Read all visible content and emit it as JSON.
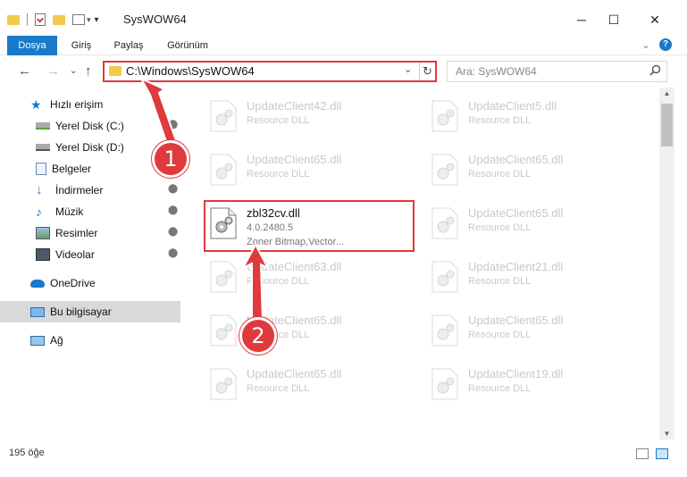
{
  "window": {
    "title": "SysWOW64",
    "minimize_glyph": "─",
    "maximize_glyph": "☐",
    "close_glyph": "✕"
  },
  "ribbon": {
    "tabs": [
      "Dosya",
      "Giriş",
      "Paylaş",
      "Görünüm"
    ],
    "active_tab": "Dosya",
    "collapse_glyph": "⌄",
    "help_glyph": "?"
  },
  "address": {
    "path": "C:\\Windows\\SysWOW64",
    "dropdown_glyph": "⌄",
    "refresh_glyph": "↻"
  },
  "search": {
    "placeholder": "Ara: SysWOW64",
    "icon": "search-icon"
  },
  "nav": {
    "back": "←",
    "forward": "→",
    "recent": "⌄",
    "up": "↑"
  },
  "sidebar": {
    "items": [
      {
        "label": "Hızlı erişim",
        "icon": "star-icon",
        "pinned": false
      },
      {
        "label": "Yerel Disk (C:)",
        "icon": "drive-icon",
        "pinned": true
      },
      {
        "label": "Yerel Disk (D:)",
        "icon": "drive-icon",
        "pinned": true
      },
      {
        "label": "Belgeler",
        "icon": "documents-icon",
        "pinned": true
      },
      {
        "label": "İndirmeler",
        "icon": "downloads-icon",
        "pinned": true
      },
      {
        "label": "Müzik",
        "icon": "music-icon",
        "pinned": true
      },
      {
        "label": "Resimler",
        "icon": "pictures-icon",
        "pinned": true
      },
      {
        "label": "Videolar",
        "icon": "videos-icon",
        "pinned": true
      },
      {
        "label": "OneDrive",
        "icon": "cloud-icon",
        "pinned": false
      },
      {
        "label": "Bu bilgisayar",
        "icon": "computer-icon",
        "pinned": false,
        "selected": true
      },
      {
        "label": "Ağ",
        "icon": "network-icon",
        "pinned": false
      }
    ],
    "pin_glyph": "📌"
  },
  "files": {
    "left_column": [
      {
        "name": "UpdateClient42.dll",
        "desc": "Resource DLL"
      },
      {
        "name": "UpdateClient65.dll",
        "desc": "Resource DLL"
      },
      {
        "name": "UpdateClient63.dll",
        "desc": "Resource DLL"
      },
      {
        "name": "UpdateClient65.dll",
        "desc": "Resource DLL"
      },
      {
        "name": "UpdateClient65.dll",
        "desc": "Resource DLL"
      }
    ],
    "right_column": [
      {
        "name": "UpdateClient5.dll",
        "desc": "Resource DLL"
      },
      {
        "name": "UpdateClient65.dll",
        "desc": "Resource DLL"
      },
      {
        "name": "UpdateClient65.dll",
        "desc": "Resource DLL"
      },
      {
        "name": "UpdateClient21.dll",
        "desc": "Resource DLL"
      },
      {
        "name": "UpdateClient65.dll",
        "desc": "Resource DLL"
      },
      {
        "name": "UpdateClient19.dll",
        "desc": "Resource DLL"
      }
    ],
    "focus_file": {
      "name": "zbl32cv.dll",
      "version": "4.0.2480.5",
      "desc": "Zoner Bitmap,Vector..."
    }
  },
  "status": {
    "item_count": "195 öğe"
  },
  "callouts": [
    "1",
    "2"
  ],
  "colors": {
    "accent": "#1979ca",
    "callout": "#e0393e",
    "folder": "#f2c94c"
  }
}
